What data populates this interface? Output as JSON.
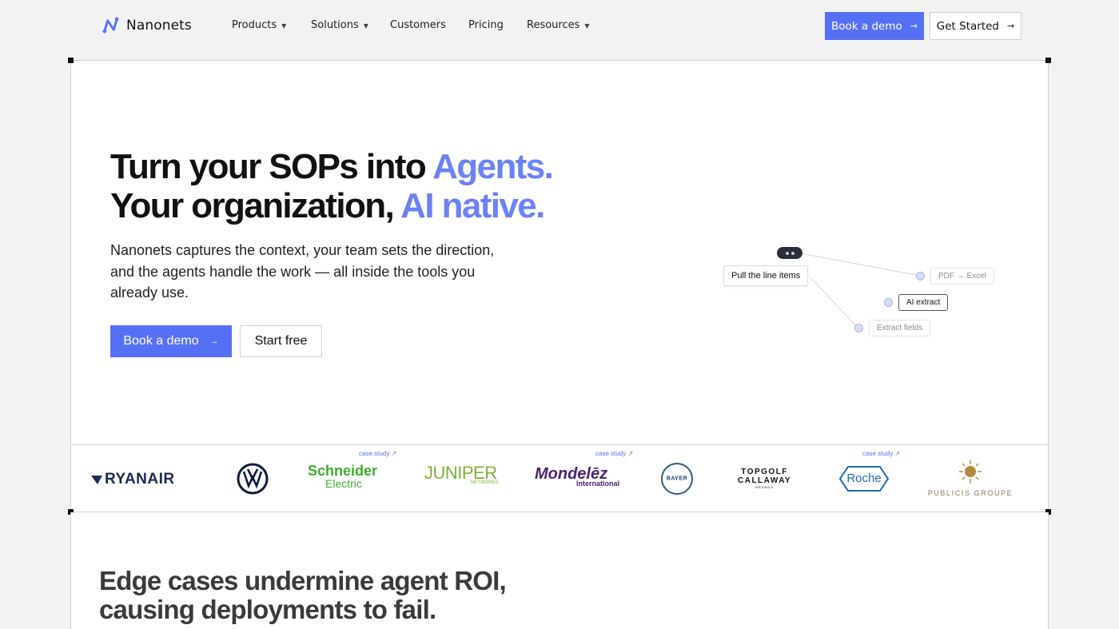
{
  "brand": {
    "name": "Nanonets",
    "accent": "#5670f5"
  },
  "nav": {
    "items": [
      {
        "label": "Products",
        "dropdown": true
      },
      {
        "label": "Solutions",
        "dropdown": true
      },
      {
        "label": "Customers",
        "dropdown": false
      },
      {
        "label": "Pricing",
        "dropdown": false
      },
      {
        "label": "Resources",
        "dropdown": true
      }
    ],
    "book_demo": "Book a demo",
    "get_started": "Get Started"
  },
  "hero": {
    "line1_plain": "Turn your SOPs into ",
    "line1_accent": "Agents.",
    "line2_plain": "Your organization, ",
    "line2_accent": "AI native.",
    "subtext": "Nanonets captures the context, your team sets the direction, and the agents handle the work — all inside the tools you already use.",
    "primary_cta": "Book a demo",
    "secondary_cta": "Start free"
  },
  "diagram": {
    "prompt": "Pull the line items",
    "nodes": [
      "PDF → Excel",
      "AI extract",
      "Extract fields"
    ]
  },
  "logos": {
    "case_label": "case study ↗",
    "brands": [
      "RYANAIR",
      "VW",
      "Schneider",
      "Electric",
      "JUNIPER",
      "NETWORKS",
      "Mondelēz",
      "International",
      "BAYER",
      "TOPGOLF",
      "CALLAWAY",
      "BRANDS",
      "Roche",
      "PUBLICIS GROUPE"
    ]
  },
  "section2": {
    "line1": "Edge cases undermine agent ROI,",
    "line2": "causing deployments to fail."
  }
}
